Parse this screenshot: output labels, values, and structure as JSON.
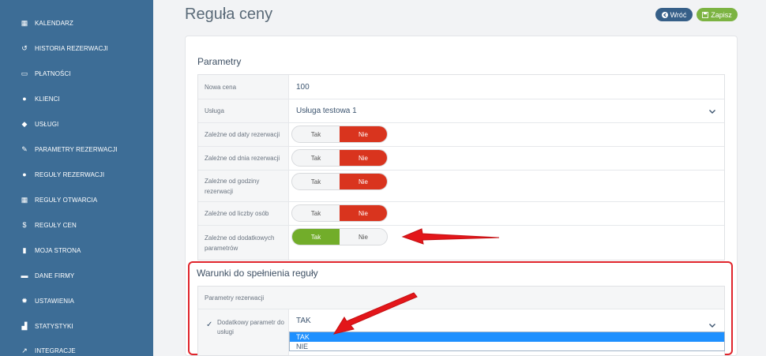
{
  "sidebar": {
    "items": [
      {
        "label": "KALENDARZ",
        "icon": "calendar-icon",
        "glyph": "▦"
      },
      {
        "label": "HISTORIA REZERWACJI",
        "icon": "history-icon",
        "glyph": "↺"
      },
      {
        "label": "PŁATNOŚCI",
        "icon": "credit-card-icon",
        "glyph": "▭"
      },
      {
        "label": "KLIENCI",
        "icon": "users-icon",
        "glyph": "●"
      },
      {
        "label": "USŁUGI",
        "icon": "cubes-icon",
        "glyph": "◆"
      },
      {
        "label": "PARAMETRY REZERWACJI",
        "icon": "wrench-icon",
        "glyph": "✎"
      },
      {
        "label": "REGUŁY REZERWACJI",
        "icon": "info-icon",
        "glyph": "●"
      },
      {
        "label": "REGUŁY OTWARCIA",
        "icon": "calendar-grid-icon",
        "glyph": "▦"
      },
      {
        "label": "REGUŁY CEN",
        "icon": "dollar-icon",
        "glyph": "$"
      },
      {
        "label": "MOJA STRONA",
        "icon": "file-icon",
        "glyph": "▮"
      },
      {
        "label": "DANE FIRMY",
        "icon": "building-icon",
        "glyph": "▬"
      },
      {
        "label": "USTAWIENIA",
        "icon": "gear-icon",
        "glyph": "✹"
      },
      {
        "label": "STATYSTYKI",
        "icon": "chart-icon",
        "glyph": "▟"
      },
      {
        "label": "INTEGRACJE",
        "icon": "external-link-icon",
        "glyph": "↗"
      }
    ]
  },
  "header": {
    "title": "Reguła ceny",
    "back_label": "Wróć",
    "save_label": "Zapisz"
  },
  "params": {
    "title": "Parametry",
    "new_price_label": "Nowa cena",
    "new_price_value": "100",
    "service_label": "Usługa",
    "service_value": "Usługa testowa 1",
    "toggles": [
      {
        "label": "Zależne od daty rezerwacji",
        "yes": "Tak",
        "no": "Nie",
        "selected": "no"
      },
      {
        "label": "Zależne od dnia rezerwacji",
        "yes": "Tak",
        "no": "Nie",
        "selected": "no"
      },
      {
        "label": "Zależne od godziny rezerwacji",
        "yes": "Tak",
        "no": "Nie",
        "selected": "no"
      },
      {
        "label": "Zależne od liczby osób",
        "yes": "Tak",
        "no": "Nie",
        "selected": "no"
      },
      {
        "label": "Zależne od dodatkowych parametrów",
        "yes": "Tak",
        "no": "Nie",
        "selected": "yes"
      }
    ]
  },
  "conditions": {
    "title": "Warunki do spełnienia reguły",
    "group_label": "Parametry rezerwacji",
    "param_label": "Dodatkowy parametr do usługi",
    "check_glyph": "✓",
    "selected_value": "TAK",
    "options": [
      "TAK",
      "NIE"
    ]
  },
  "colors": {
    "sidebar": "#3d6d96",
    "toggle_no": "#d9341e",
    "toggle_yes": "#72ad2a",
    "highlight": "#e0252c",
    "back_button": "#365f88",
    "save_button": "#7cb342"
  }
}
